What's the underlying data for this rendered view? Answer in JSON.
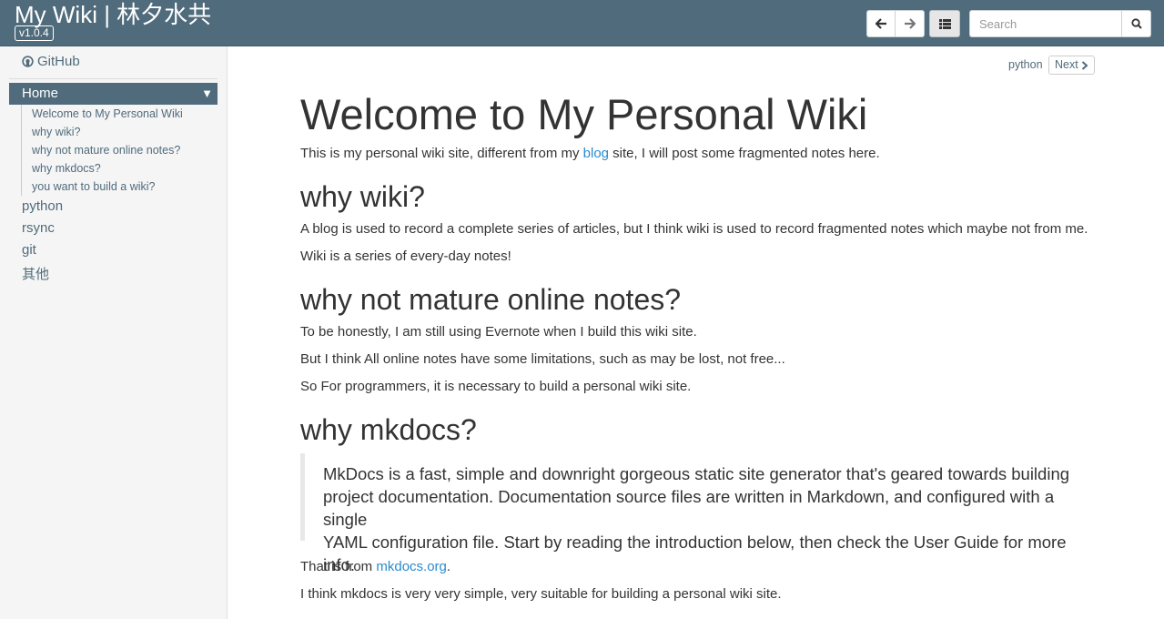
{
  "header": {
    "title": "My Wiki | 林夕水共",
    "version": "v1.0.4",
    "search_placeholder": "Search"
  },
  "sidebar": {
    "github_label": "GitHub",
    "home_label": "Home",
    "toc": [
      "Welcome to My Personal Wiki",
      "why wiki?",
      "why not mature online notes?",
      "why mkdocs?",
      "you want to build a wiki?"
    ],
    "nav": [
      "python",
      "rsync",
      "git",
      "其他"
    ]
  },
  "pager": {
    "next_page_title": "python",
    "next_label": "Next"
  },
  "content": {
    "title": "Welcome to My Personal Wiki",
    "intro_before": "This is my personal wiki site, different from my ",
    "intro_link": "blog",
    "intro_after": " site, I will post some fragmented notes here.",
    "h_why_wiki": "why wiki?",
    "p_wiki_1": "A blog is used to record a complete series of articles, but I think wiki is used to record fragmented notes which maybe not from me.",
    "p_wiki_2": "Wiki is a series of every-day notes!",
    "h_why_not": "why not mature online notes?",
    "p_notes_1": "To be honestly, I am still using Evernote when I build this wiki site.",
    "p_notes_2": "But I think All online notes have some limitations, such as may be lost, not free...",
    "p_notes_3": "So For programmers, it is necessary to build a personal wiki site.",
    "h_why_mkdocs": "why mkdocs?",
    "quote_lines": [
      "MkDocs is a fast, simple and downright gorgeous static site generator that's geared towards building",
      "project documentation. Documentation source files are written in Markdown, and configured with a single",
      "YAML configuration file. Start by reading the introduction below, then check the User Guide for more info."
    ],
    "from_before": "That is from ",
    "from_link": "mkdocs.org",
    "from_after": ".",
    "p_last": "I think mkdocs is very very simple, very suitable for building a personal wiki site."
  },
  "icons": {
    "back": "arrow-left-icon",
    "forward": "arrow-right-icon",
    "toc": "list-icon",
    "search": "search-icon",
    "github": "github-icon",
    "caret": "caret-down-icon",
    "next": "chevron-right-icon"
  },
  "colors": {
    "header_bg": "#506b7b",
    "link": "#2a8bd0",
    "sidebar_bg": "#f5f5f5"
  }
}
